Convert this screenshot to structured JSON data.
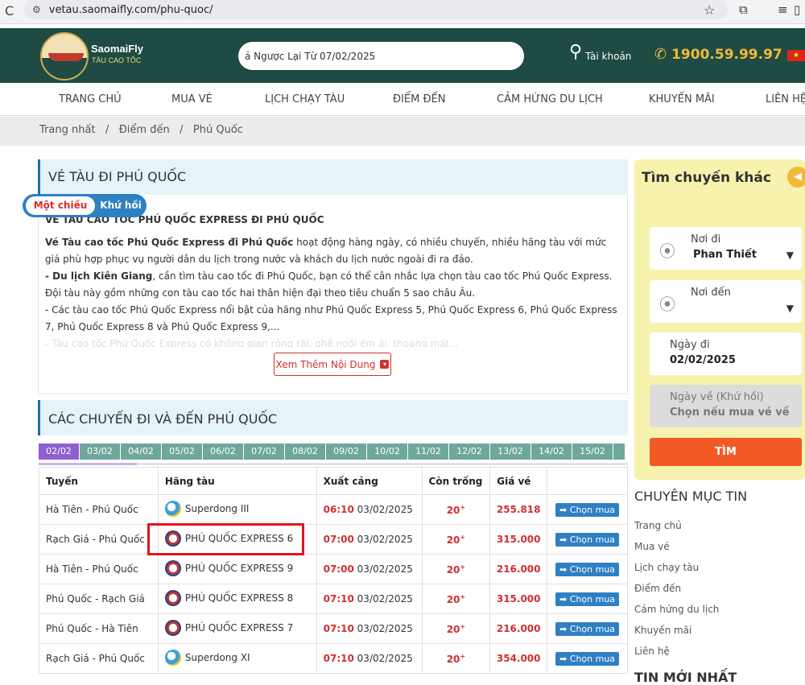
{
  "browser": {
    "url": "vetau.saomaifly.com/phu-quoc/"
  },
  "header": {
    "brand": "SaomaiFly",
    "brand_sub": "TÀU CAO TỐC",
    "search_value": "ả Ngược Lại Từ 07/02/2025",
    "account": "Tài khoản",
    "phone": "1900.59.99.97",
    "flag": "★"
  },
  "menu": [
    "TRANG CHỦ",
    "MUA VÉ",
    "LỊCH CHẠY TÀU",
    "ĐIỂM ĐẾN",
    "CẢM HỨNG DU LỊCH",
    "KHUYẾN MÃI",
    "LIÊN HỆ"
  ],
  "breadcrumb": [
    "Trang nhất",
    "Điểm đến",
    "Phú Quốc"
  ],
  "article": {
    "section_title": "VÉ TÀU ĐI PHÚ QUỐC",
    "heading": "VÉ TÀU CAO TỐC PHÚ QUỐC EXPRESS ĐI PHÚ QUỐC",
    "p1_bold": "Vé Tàu cao tốc Phú Quốc Express đi Phú Quốc",
    "p1_rest": " hoạt động hàng ngày, có nhiều chuyến, nhiều hãng tàu với mức giá phù hợp phục vụ người dân du lịch trong nước và khách du lịch nước ngoài đi ra đảo.",
    "p2_bold": " - Du lịch Kiên Giang",
    "p2_rest": ", cần tìm tàu cao tốc đi Phú Quốc, bạn có thể cân nhắc lựa chọn tàu cao tốc Phú Quốc Express. Đội tàu này gồm những con tàu cao tốc hai thân hiện đại theo tiêu chuẩn 5 sao châu Âu.",
    "p3": " - Các tàu cao tốc Phú Quốc Express nổi bật của hãng như Phú Quốc Express 5, Phú Quốc Express 6, Phú Quốc Express 7, Phú Quốc Express 8 và Phú Quốc Express 9,...",
    "p4_faded": " - Tàu cao tốc Phú Quốc Express có không gian rộng rãi, ghế ngồi êm ái, thoáng mát...",
    "more_button": "Xem Thêm Nội Dung"
  },
  "trips": {
    "section_title": "CÁC CHUYẾN ĐI VÀ ĐẾN PHÚ QUỐC",
    "dates": [
      "02/02",
      "03/02",
      "04/02",
      "05/02",
      "06/02",
      "07/02",
      "08/02",
      "09/02",
      "10/02",
      "11/02",
      "12/02",
      "13/02",
      "14/02",
      "15/02"
    ],
    "columns": [
      "Tuyến",
      "Hãng tàu",
      "Xuất cảng",
      "Còn trống",
      "Giá vé",
      ""
    ],
    "rows": [
      {
        "route": "Hà Tiên - Phú Quốc",
        "ship": "Superdong III",
        "icon": "superdong-icon",
        "time": "06:10",
        "date": "03/02/2025",
        "seats": "20",
        "price": "255.818",
        "action": "Chọn mua"
      },
      {
        "route": "Rạch Giá - Phú Quốc",
        "ship": "PHÚ QUỐC EXPRESS 6",
        "icon": "pq-express-icon",
        "time": "07:00",
        "date": "03/02/2025",
        "seats": "20",
        "price": "315.000",
        "action": "Chọn mua"
      },
      {
        "route": "Hà Tiên - Phú Quốc",
        "ship": "PHÚ QUỐC EXPRESS 9",
        "icon": "pq-express-icon",
        "time": "07:00",
        "date": "03/02/2025",
        "seats": "20",
        "price": "216.000",
        "action": "Chọn mua"
      },
      {
        "route": "Phú Quốc - Rạch Giá",
        "ship": "PHÚ QUỐC EXPRESS 8",
        "icon": "pq-express-icon",
        "time": "07:10",
        "date": "03/02/2025",
        "seats": "20",
        "price": "315.000",
        "action": "Chọn mua"
      },
      {
        "route": "Phú Quốc - Hà Tiên",
        "ship": "PHÚ QUỐC EXPRESS 7",
        "icon": "pq-express-icon",
        "time": "07:10",
        "date": "03/02/2025",
        "seats": "20",
        "price": "216.000",
        "action": "Chọn mua"
      },
      {
        "route": "Rạch Giá - Phú Quốc",
        "ship": "Superdong XI",
        "icon": "superdong-icon",
        "time": "07:10",
        "date": "03/02/2025",
        "seats": "20",
        "price": "354.000",
        "action": "Chọn mua"
      }
    ]
  },
  "sidebar": {
    "title": "Tìm chuyến khác",
    "one_way": "Một chiều",
    "round_trip": "Khứ hồi",
    "from_label": "Nơi đi",
    "from_value": "Phan Thiết",
    "to_label": "Nơi đến",
    "depart_label": "Ngày đi",
    "depart_value": "02/02/2025",
    "return_label": "Ngày về (Khứ hồi)",
    "return_hint": "Chọn nếu mua vé về",
    "search_button": "TÌM",
    "categories_title": "CHUYÊN MỤC TIN",
    "categories": [
      "Trang chủ",
      "Mua vé",
      "Lịch chạy tàu",
      "Điểm đến",
      "Cảm hứng du lịch",
      "Khuyến mãi",
      "Liên hệ"
    ],
    "news_title": "TIN MỚI NHẤT"
  }
}
